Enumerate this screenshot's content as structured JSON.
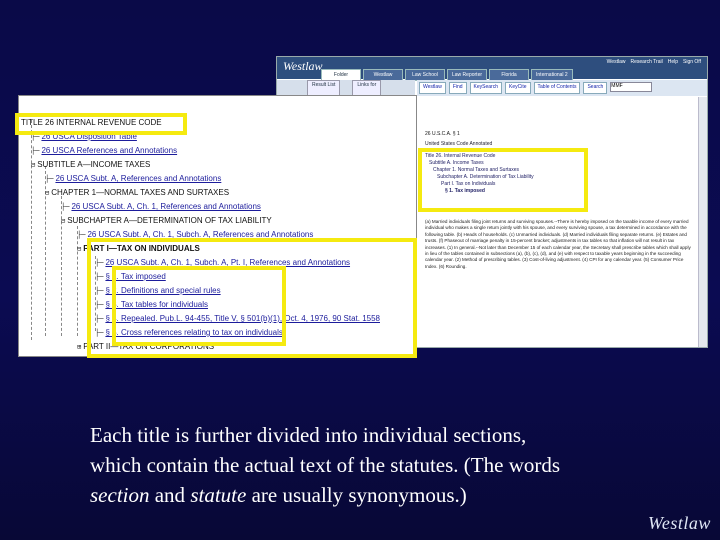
{
  "westlaw": {
    "logo": "Westlaw",
    "tabs": [
      "Folder",
      "Westlaw",
      "Law School",
      "Law Reporter",
      "Florida",
      "International 2"
    ],
    "active_tab": 0,
    "top_links": [
      "Westlaw",
      "Research Trail",
      "Help",
      "Sign Off"
    ],
    "toolbar": [
      "Westlaw",
      "Find",
      "KeySearch",
      "KeyCite",
      "Table of Contents",
      "Search"
    ],
    "find_value": "MMF",
    "left_head_buttons": [
      "Result List",
      "Links for"
    ],
    "doc": {
      "cite": "26 U.S.C.A. § 1",
      "heading": "United States Code Annotated",
      "breadcrumbs": [
        "Title 26. Internal Revenue Code",
        "Subtitle A. Income Taxes",
        "Chapter 1. Normal Taxes and Surtaxes",
        "Subchapter A. Determination of Tax Liability",
        "Part I. Tax on Individuals",
        "§ 1. Tax imposed"
      ],
      "body": "(a) Married individuals filing joint returns and surviving spouses.--There is hereby imposed on the taxable income of every married individual who makes a single return jointly with his spouse, and every surviving spouse, a tax determined in accordance with the following table. (b) Heads of households. (c) Unmarried individuals. (d) Married individuals filing separate returns. (e) Estates and trusts. (f) Phaseout of marriage penalty in 15-percent bracket; adjustments in tax tables so that inflation will not result in tax increases. (1) In general.--Not later than December 15 of each calendar year, the Secretary shall prescribe tables which shall apply in lieu of the tables contained in subsections (a), (b), (c), (d), and (e) with respect to taxable years beginning in the succeeding calendar year. (2) Method of prescribing tables. (3) Cost-of-living adjustment. (4) CPI for any calendar year. (5) Consumer Price Index. (6) Rounding."
    }
  },
  "tree": [
    {
      "sym": "",
      "label": "TITLE 26 INTERNAL REVENUE CODE",
      "plain": true
    },
    {
      "sym": "├─",
      "label": "26 USCA Disposition Table"
    },
    {
      "sym": "├─",
      "label": "26 USCA References and Annotations"
    },
    {
      "sym": "⊟",
      "label": "SUBTITLE A—INCOME TAXES",
      "plain": true
    },
    {
      "sym": "├─",
      "label": "26 USCA Subt. A, References and Annotations"
    },
    {
      "sym": "⊟",
      "label": "CHAPTER 1—NORMAL TAXES AND SURTAXES",
      "plain": true
    },
    {
      "sym": "├─",
      "label": "26 USCA Subt. A, Ch. 1, References and Annotations"
    },
    {
      "sym": "⊟",
      "label": "SUBCHAPTER A—DETERMINATION OF TAX LIABILITY",
      "plain": true
    },
    {
      "sym": "├─",
      "label": "26 USCA Subt. A, Ch. 1, Subch. A, References and Annotations"
    },
    {
      "sym": "⊟",
      "label": "PART I—TAX ON INDIVIDUALS",
      "bold": true
    },
    {
      "sym": "├─",
      "label": "26 USCA Subt. A, Ch. 1, Subch. A, Pt. I, References and Annotations"
    },
    {
      "sym": "├─",
      "label": "§ 1. Tax imposed"
    },
    {
      "sym": "├─",
      "label": "§ 2. Definitions and special rules"
    },
    {
      "sym": "├─",
      "label": "§ 3. Tax tables for individuals"
    },
    {
      "sym": "├─",
      "label": "§ 4. Repealed. Pub.L. 94-455, Title V, § 501(b)(1), Oct. 4, 1976, 90 Stat. 1558"
    },
    {
      "sym": "├─",
      "label": "§ 5. Cross references relating to tax on individuals"
    },
    {
      "sym": "⊞",
      "label": "PART II—TAX ON CORPORATIONS",
      "plain": true
    }
  ],
  "caption": {
    "line1": "Each title is further divided into individual sections,",
    "line2": "which contain the actual text of the statutes.",
    "line2b": "(The words",
    "line3_em1": "section",
    "line3_mid": " and ",
    "line3_em2": "statute",
    "line3_end": " are usually synonymous.)"
  },
  "footer_logo": "Westlaw",
  "colors": {
    "background": "#0a0a48",
    "highlight": "#f5ea10",
    "link": "#1c1c9c"
  }
}
